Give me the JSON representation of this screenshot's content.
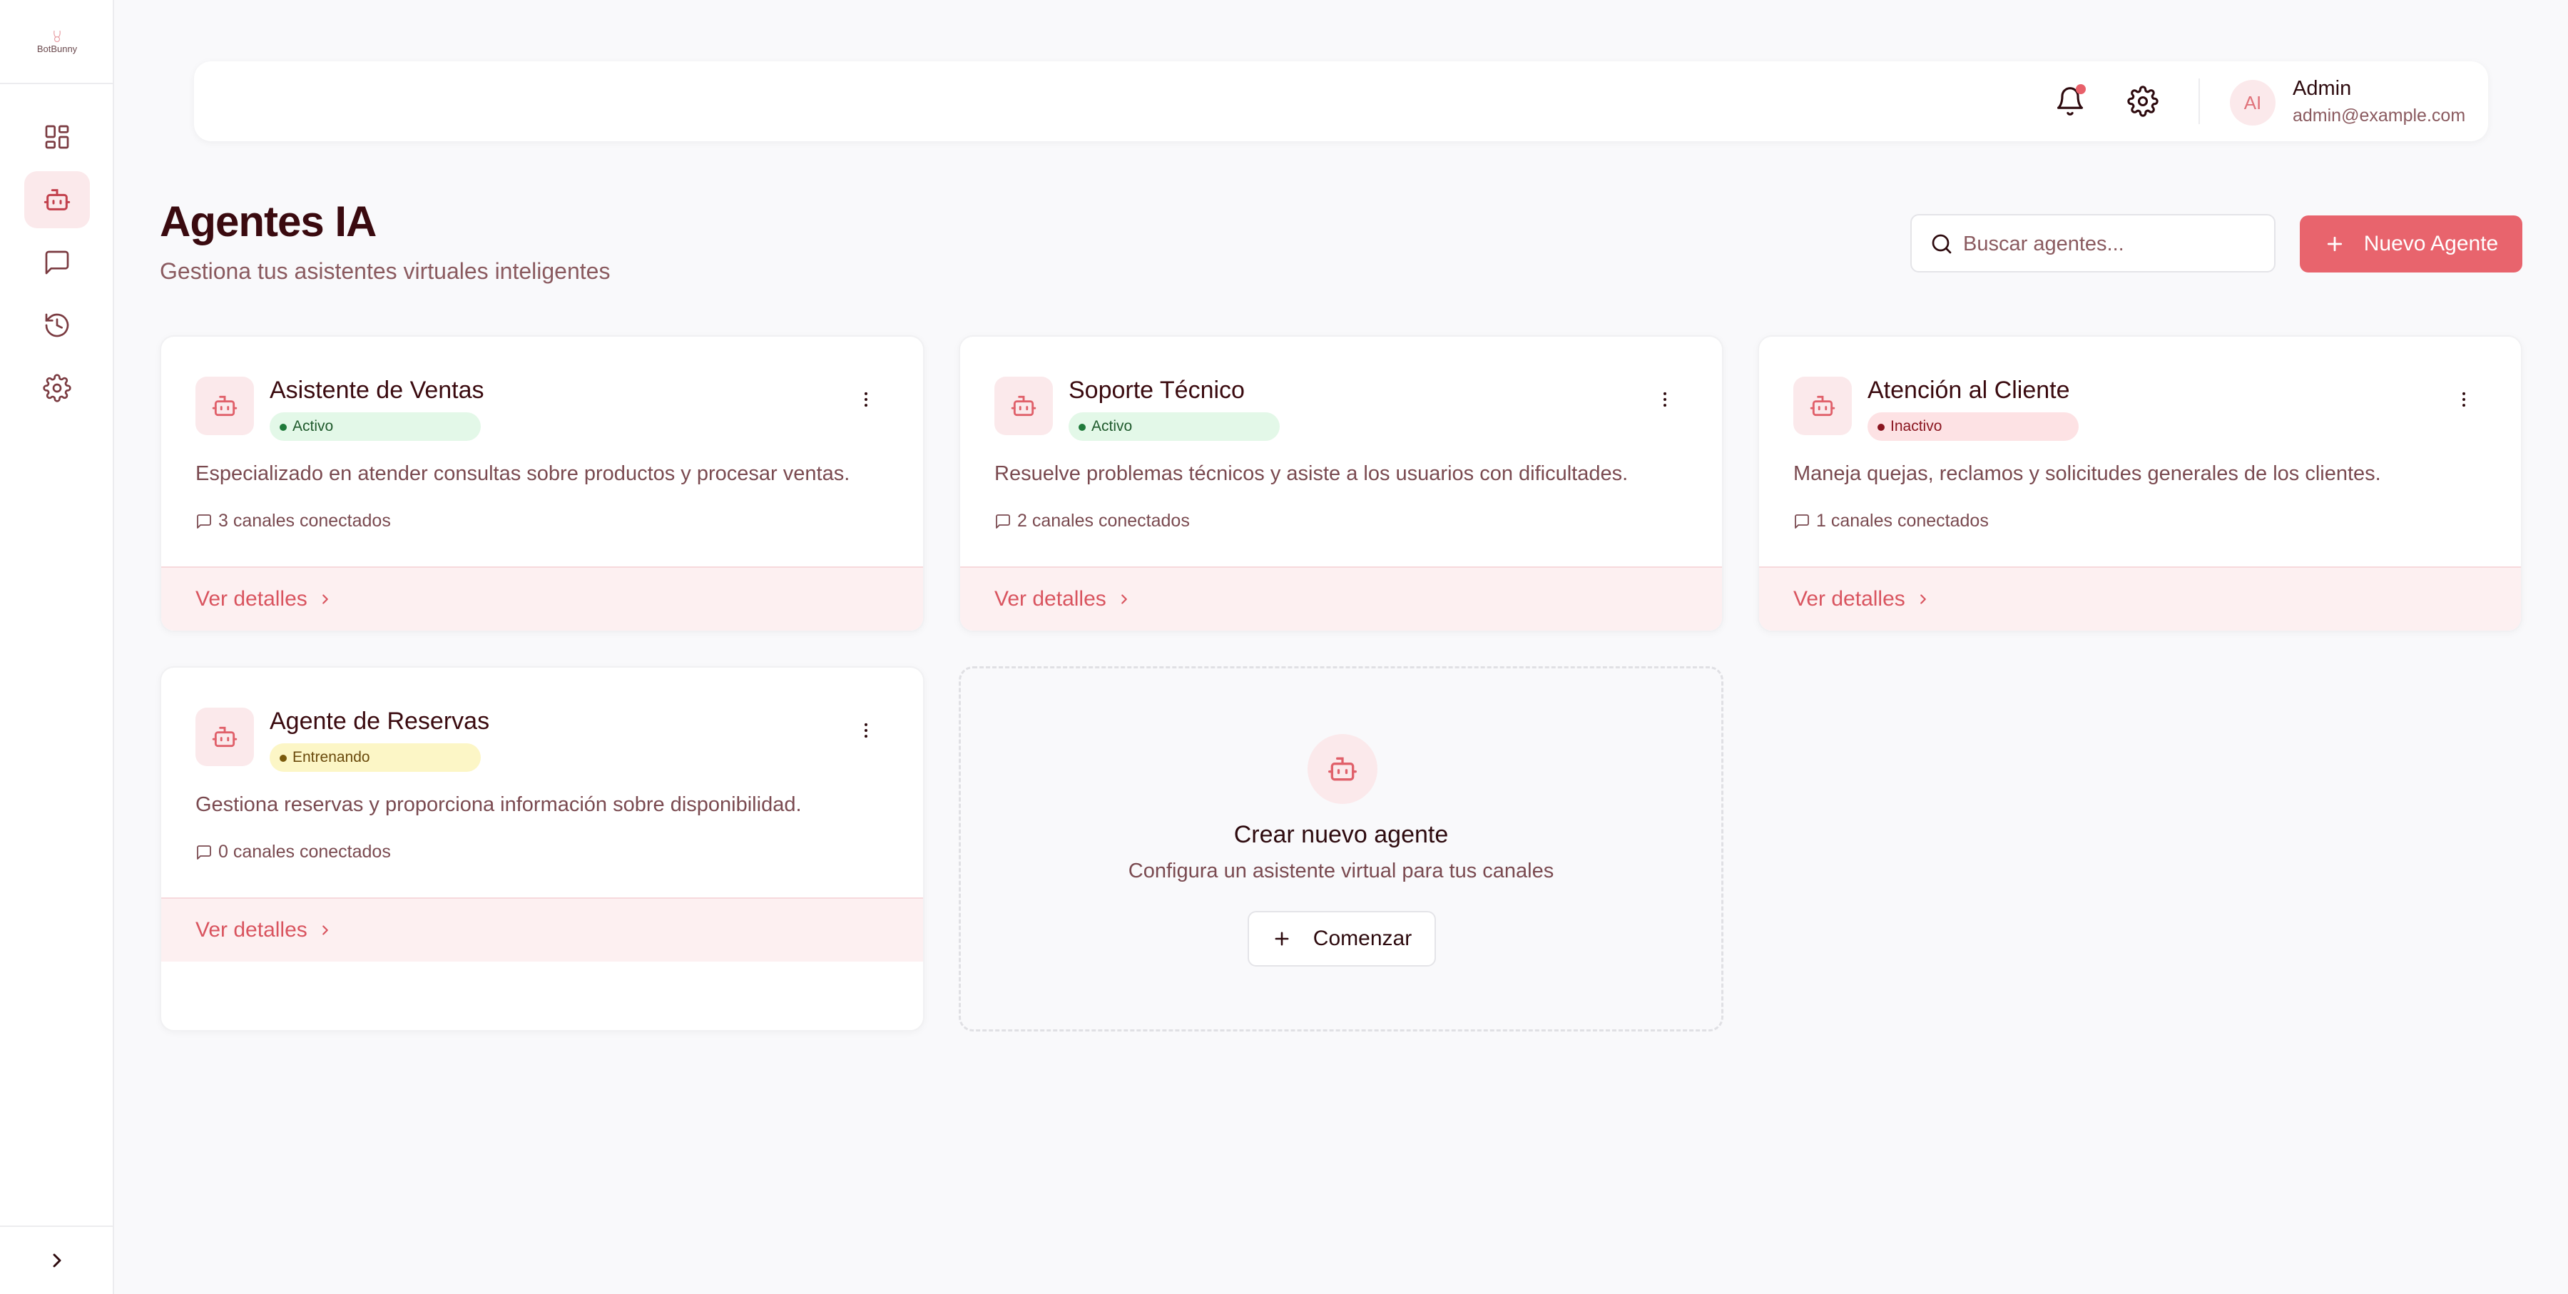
{
  "app": {
    "logo_text": "BotBunny"
  },
  "sidebar": {
    "items": [
      {
        "name": "dashboard",
        "icon": "dashboard-icon"
      },
      {
        "name": "agents",
        "icon": "bot-icon",
        "active": true
      },
      {
        "name": "messages",
        "icon": "message-icon"
      },
      {
        "name": "history",
        "icon": "history-icon"
      },
      {
        "name": "settings",
        "icon": "gear-icon"
      }
    ],
    "expand_icon": "chevron-right-icon"
  },
  "header": {
    "user_initials": "AI",
    "user_name": "Admin",
    "user_email": "admin@example.com",
    "notification_dot_color": "#e8606a"
  },
  "page": {
    "title": "Agentes IA",
    "subtitle": "Gestiona tus asistentes virtuales inteligentes",
    "search_placeholder": "Buscar agentes...",
    "new_button_label": "Nuevo Agente"
  },
  "colors": {
    "accent": "#e8646d",
    "accent_soft": "#fbe9eb",
    "title": "#3a0a0f"
  },
  "agents": [
    {
      "name": "Asistente de Ventas",
      "status": "Activo",
      "description": "Especializado en atender consultas sobre productos y procesar ventas.",
      "channels": "3 canales conectados",
      "details_label": "Ver detalles"
    },
    {
      "name": "Soporte Técnico",
      "status": "Activo",
      "description": "Resuelve problemas técnicos y asiste a los usuarios con dificultades.",
      "channels": "2 canales conectados",
      "details_label": "Ver detalles"
    },
    {
      "name": "Atención al Cliente",
      "status": "Inactivo",
      "description": "Maneja quejas, reclamos y solicitudes generales de los clientes.",
      "channels": "1 canales conectados",
      "details_label": "Ver detalles"
    },
    {
      "name": "Agente de Reservas",
      "status": "Entrenando",
      "description": "Gestiona reservas y proporciona información sobre disponibilidad.",
      "channels": "0 canales conectados",
      "details_label": "Ver detalles"
    }
  ],
  "create_card": {
    "title": "Crear nuevo agente",
    "subtitle": "Configura un asistente virtual para tus canales",
    "button_label": "Comenzar"
  }
}
